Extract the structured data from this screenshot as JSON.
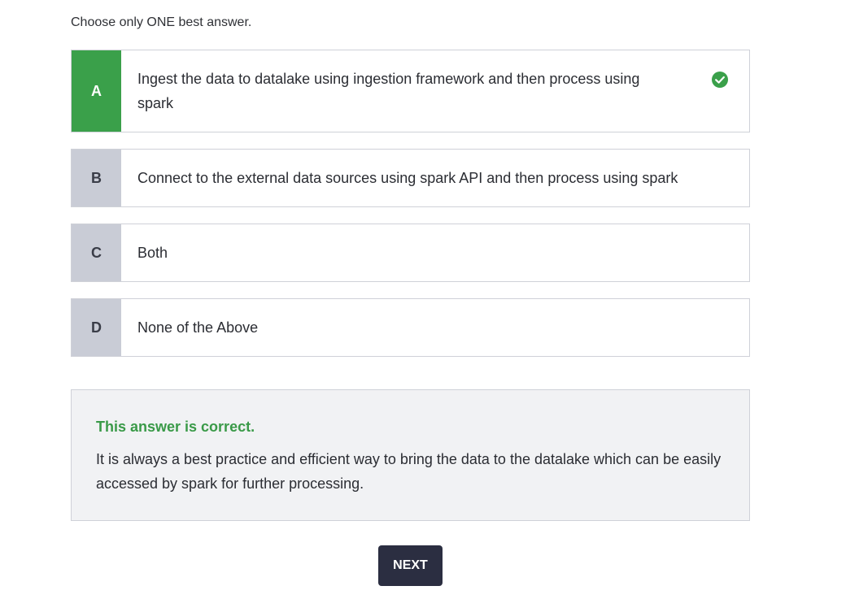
{
  "instruction": "Choose only ONE best answer.",
  "options": [
    {
      "letter": "A",
      "text": "Ingest the data to datalake using ingestion framework and then process using spark",
      "selected": true
    },
    {
      "letter": "B",
      "text": "Connect to the external data sources using spark API and then process using spark",
      "selected": false
    },
    {
      "letter": "C",
      "text": "Both",
      "selected": false
    },
    {
      "letter": "D",
      "text": "None of the Above",
      "selected": false
    }
  ],
  "feedback": {
    "title": "This answer is correct.",
    "explanation": "It is always a best practice and efficient way to bring the data to the datalake which can be easily accessed by spark for further processing."
  },
  "next_label": "NEXT",
  "colors": {
    "correct": "#3aa04a",
    "letter_bg": "#c9ccd6",
    "button": "#2b2e41"
  },
  "icons": {
    "selected_check": "check-circle-icon"
  }
}
